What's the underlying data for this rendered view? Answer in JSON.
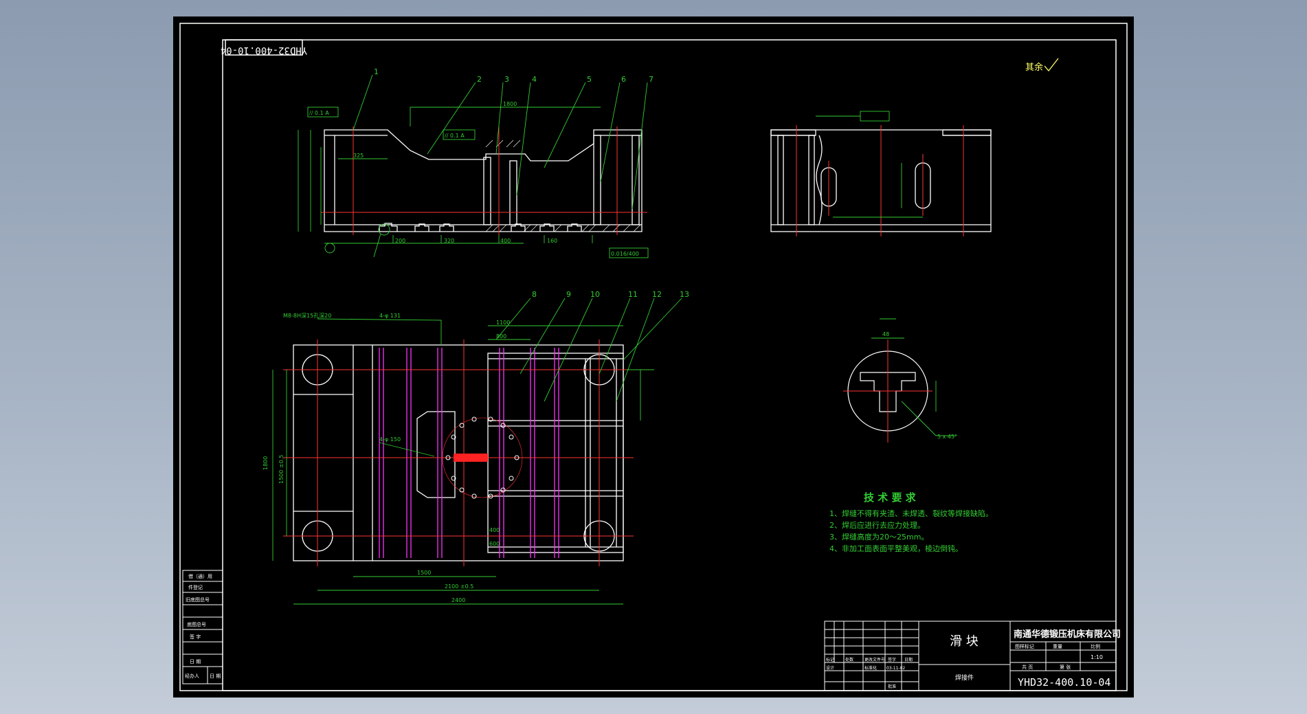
{
  "drawing": {
    "mirrored_code": "YHD32-400.10-04",
    "part_name": "滑 块",
    "company": "南通华德锻压机床有限公司",
    "drawing_number": "YHD32-400.10-04",
    "material_note": "焊接件",
    "scale_label": "比例",
    "scale": "1:10",
    "weight_label": "重量",
    "stage_label": "图样标记",
    "sheet_label": "共  页",
    "sheet_of": "第  张",
    "surface_note": "其余",
    "tech_title": "技 术 要 求",
    "requirements": [
      "1、焊缝不得有夹渣、未焊透、裂纹等焊接缺陷。",
      "2、焊后应进行去应力处理。",
      "3、焊缝高度为20～25mm。",
      "4、非加工面表面平整美观，棱边倒钝。"
    ],
    "left_table": [
      "借（通）用",
      "件登记",
      "旧底图总号",
      "底图总号",
      "签  字",
      "日  期",
      "签　字",
      "经办人",
      "日  期"
    ],
    "title_block_cells": [
      "标记",
      "处数",
      "更改文件号",
      "签字",
      "日期",
      "设计",
      "标准化",
      "审核",
      "工艺",
      "批准",
      "03-11-02"
    ],
    "balloons": [
      "1",
      "2",
      "3",
      "4",
      "5",
      "6",
      "7",
      "8",
      "9",
      "10",
      "11",
      "12",
      "13"
    ],
    "dims": {
      "d2100": "2100 ±0.5",
      "d2400": "2400",
      "d1800": "1800",
      "d1500": "1500",
      "d1100": "1100",
      "d800": "800",
      "d600": "600",
      "d400": "400",
      "d325": "325",
      "d1800v": "1800",
      "d1500v": "1500 ±0.5",
      "d200": "200",
      "d320": "320",
      "d160": "160",
      "d48": "48",
      "d5x45": "5 x 45°",
      "d_flat": "0.016/400",
      "tol_01": "// 0.1 A",
      "tol_03": "0.3",
      "d4phi": "4-φ 131",
      "d_holes": "M8-8H深15孔深20",
      "d_holes2": "4-φ 150"
    }
  }
}
